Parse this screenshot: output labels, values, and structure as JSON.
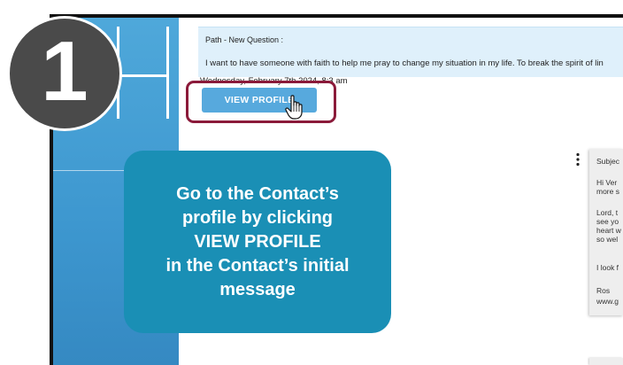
{
  "step": {
    "number": "1"
  },
  "question": {
    "path_label": "Path - New Question :",
    "text": "I want to have someone with faith to help me pray to change my situation in my life. To break the spirit of lin",
    "date": "Wednesday, February 7th 2024, 8:3  am",
    "view_profile_label": "VIEW PROFILE"
  },
  "reply": {
    "lines": [
      {
        "text": "Subjec"
      },
      {
        "text": "Hi Ver"
      },
      {
        "text": "more s"
      },
      {
        "text": "Lord, t"
      },
      {
        "text": "see yo"
      },
      {
        "text": "heart w"
      },
      {
        "text": "so wel"
      },
      {
        "text": "I look f"
      },
      {
        "text": "Ros"
      },
      {
        "text": "www.g"
      }
    ]
  },
  "callout": {
    "lines": [
      "Go to the Contact’s",
      "profile by clicking",
      "VIEW PROFILE",
      "in the Contact’s initial",
      "message"
    ]
  },
  "colors": {
    "sidebar": "#4fa8da",
    "callout": "#1a8fb5",
    "highlight": "#8b1a3a",
    "button": "#57a9dd",
    "badge": "#4a4a4a"
  }
}
